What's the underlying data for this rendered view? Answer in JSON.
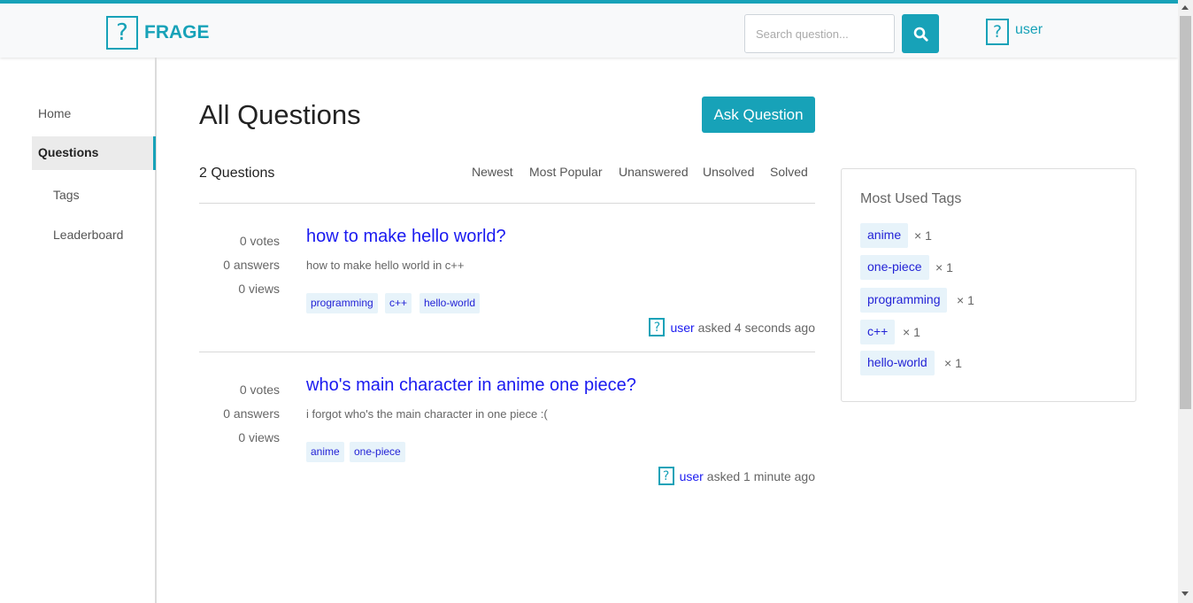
{
  "header": {
    "logo_symbol": "?",
    "logo_text": "FRAGE",
    "search_placeholder": "Search question...",
    "user_symbol": "?",
    "user_name": "user",
    "accent_color": "#17a2b8"
  },
  "sidebar": {
    "items": [
      {
        "label": "Home"
      },
      {
        "label": "Questions"
      },
      {
        "label": "Tags"
      },
      {
        "label": "Leaderboard"
      }
    ]
  },
  "main": {
    "title": "All Questions",
    "ask_button": "Ask Question",
    "count": "2 Questions",
    "filters": [
      "Newest",
      "Most Popular",
      "Unanswered",
      "Unsolved",
      "Solved"
    ],
    "questions": [
      {
        "votes": "0 votes",
        "answers": "0 answers",
        "views": "0 views",
        "title": "how to make hello world?",
        "excerpt": "how to make hello world in c++",
        "tags": [
          "programming",
          "c++",
          "hello-world"
        ],
        "asked_symbol": "?",
        "author": "user",
        "asked": "asked 4 seconds ago"
      },
      {
        "votes": "0 votes",
        "answers": "0 answers",
        "views": "0 views",
        "title": "who's main character in anime one piece?",
        "excerpt": "i forgot who's the main character in one piece :(",
        "tags": [
          "anime",
          "one-piece"
        ],
        "asked_symbol": "?",
        "author": "user",
        "asked": "asked 1 minute ago"
      }
    ]
  },
  "most_used_tags": {
    "title": "Most Used Tags",
    "tags": [
      {
        "name": "anime",
        "count": "× 1"
      },
      {
        "name": "one-piece",
        "count": "× 1"
      },
      {
        "name": "programming",
        "count": "× 1"
      },
      {
        "name": "c++",
        "count": "× 1"
      },
      {
        "name": "hello-world",
        "count": "× 1"
      }
    ]
  }
}
